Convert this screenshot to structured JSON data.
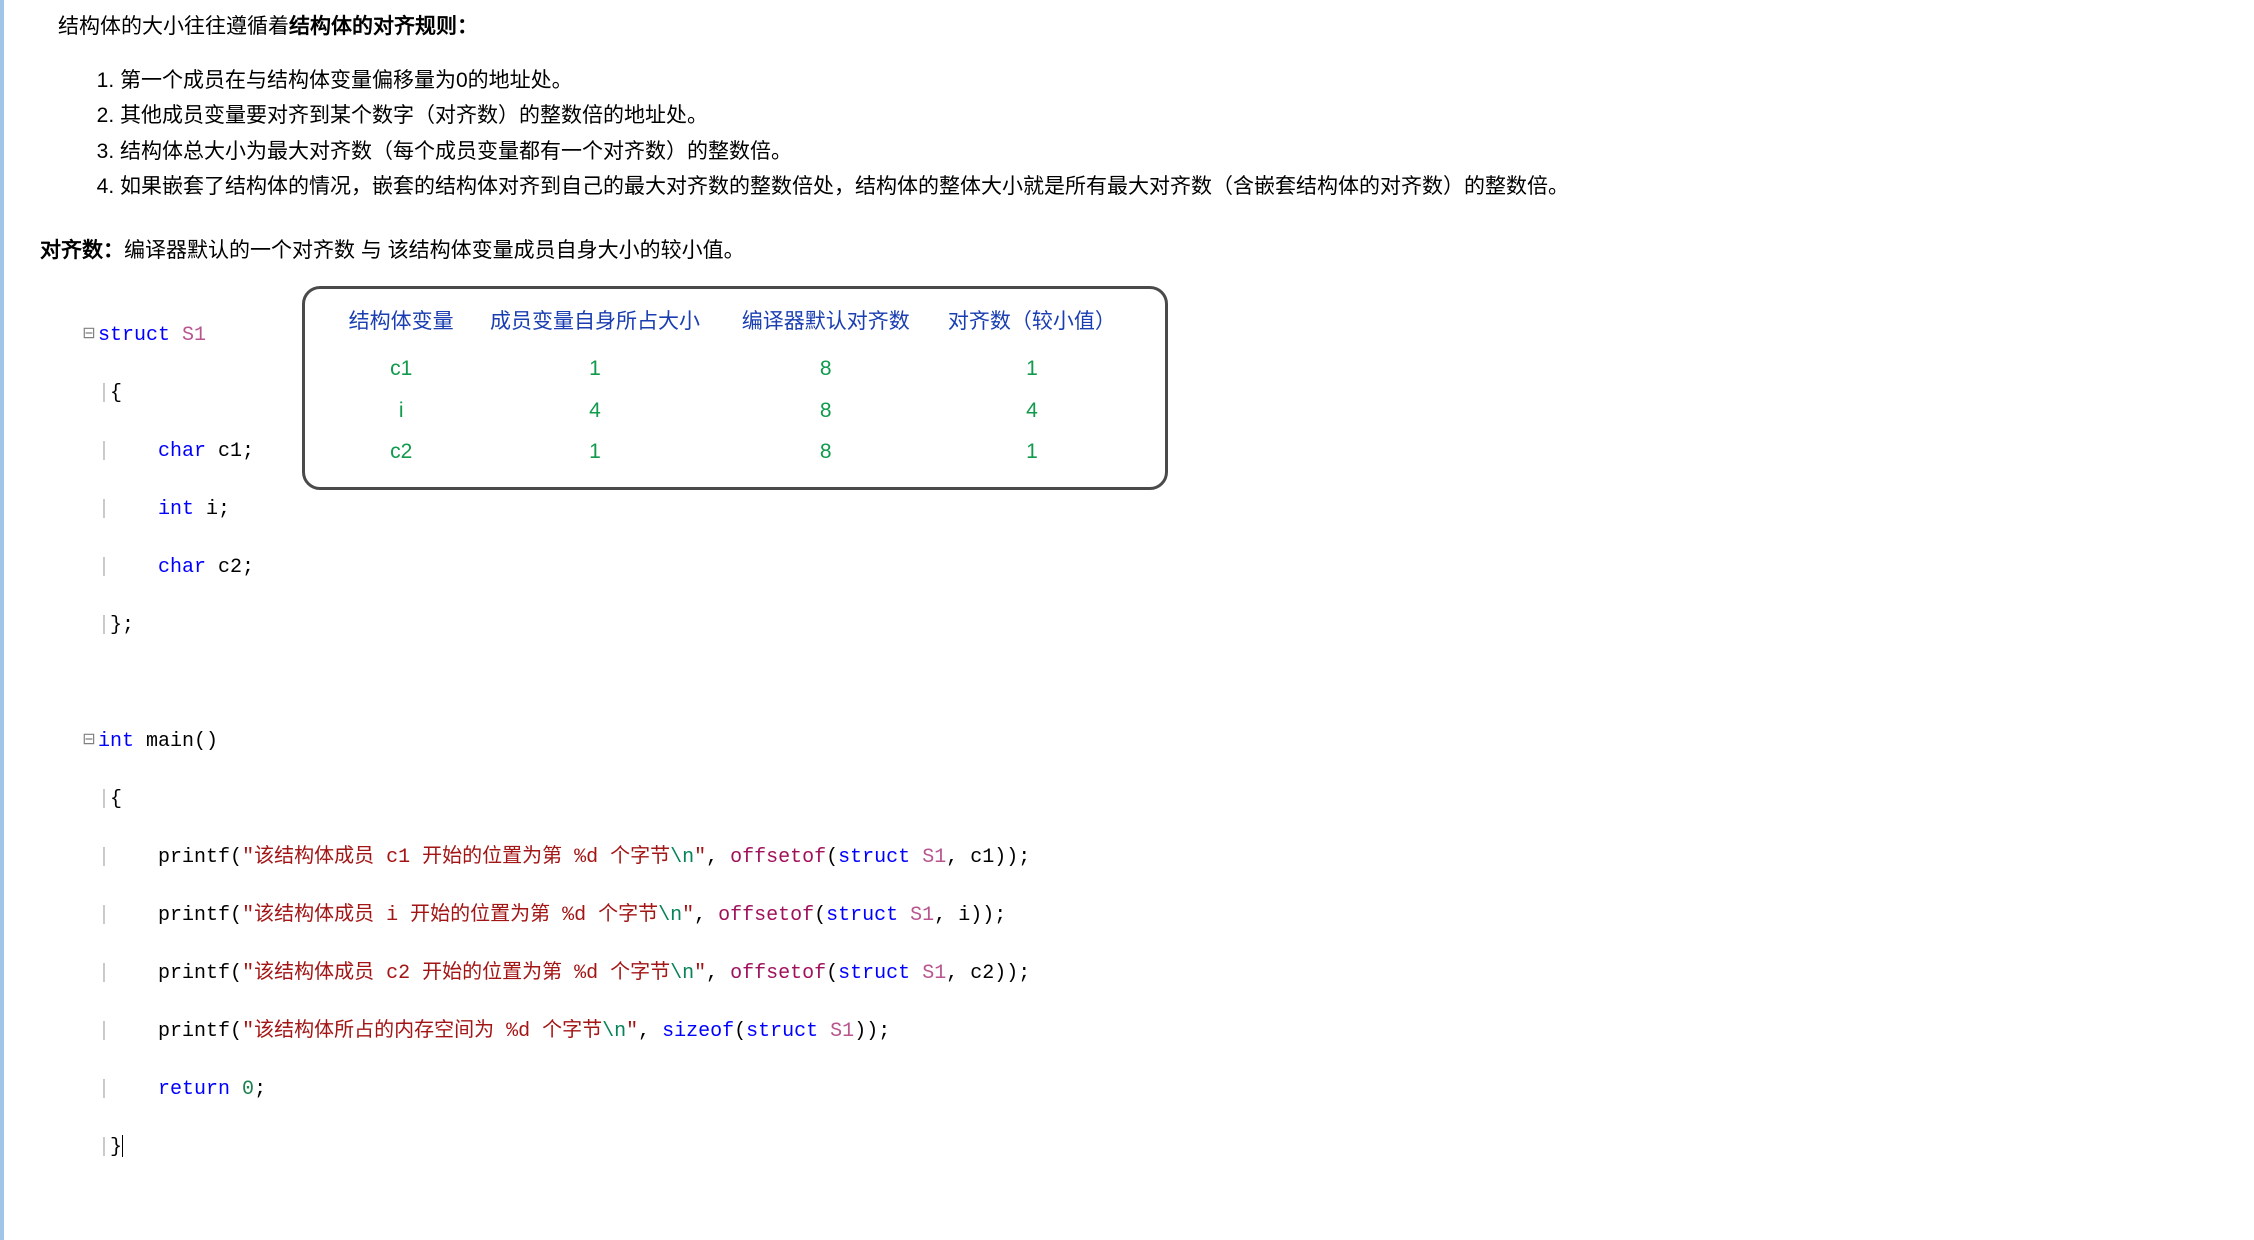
{
  "intro_prefix": "结构体的大小往往遵循着",
  "intro_bold": "结构体的对齐规则：",
  "rules": [
    "第一个成员在与结构体变量偏移量为0的地址处。",
    "其他成员变量要对齐到某个数字（对齐数）的整数倍的地址处。",
    "结构体总大小为最大对齐数（每个成员变量都有一个对齐数）的整数倍。",
    "如果嵌套了结构体的情况，嵌套的结构体对齐到自己的最大对齐数的整数倍处，结构体的整体大小就是所有最大对齐数（含嵌套结构体的对齐数）的整数倍。"
  ],
  "align_label": "对齐数：",
  "align_desc": "编译器默认的一个对齐数 与 该结构体变量成员自身大小的较小值。",
  "table": {
    "headers": [
      "结构体变量",
      "成员变量自身所占大小",
      "编译器默认对齐数",
      "对齐数（较小值）"
    ],
    "rows": [
      [
        "c1",
        "1",
        "8",
        "1"
      ],
      [
        "i",
        "4",
        "8",
        "4"
      ],
      [
        "c2",
        "1",
        "8",
        "1"
      ]
    ]
  },
  "code": {
    "kw_struct": "struct",
    "struct_name": "S1",
    "brace_open": "{",
    "type_char": "char",
    "decl_c1": " c1;",
    "type_int": "int",
    "decl_i": " i;",
    "decl_c2": " c2;",
    "brace_close_semi": "};",
    "main_sig": " main()",
    "printf": "printf",
    "str1_a": "\"该结构体成员 c1 开始的位置为第 %d 个字节",
    "str1_b": "\\n",
    "str1_c": "\"",
    "sep": ", ",
    "offsetof": "offsetof",
    "arg1": "(",
    "arg_struct": "struct",
    "arg_name": " S1",
    "arg_c1": ", c1));",
    "str2_a": "\"该结构体成员 i 开始的位置为第 %d 个字节",
    "arg_i": ", i));",
    "str3_a": "\"该结构体成员 c2 开始的位置为第 %d 个字节",
    "arg_c2": ", c2));",
    "str4_a": "\"该结构体所占的内存空间为 %d 个字节",
    "sizeof": "sizeof",
    "arg_s1_only": "));",
    "return_kw": "return",
    "return_val": " 0",
    "semicolon": ";",
    "brace_close": "}"
  }
}
